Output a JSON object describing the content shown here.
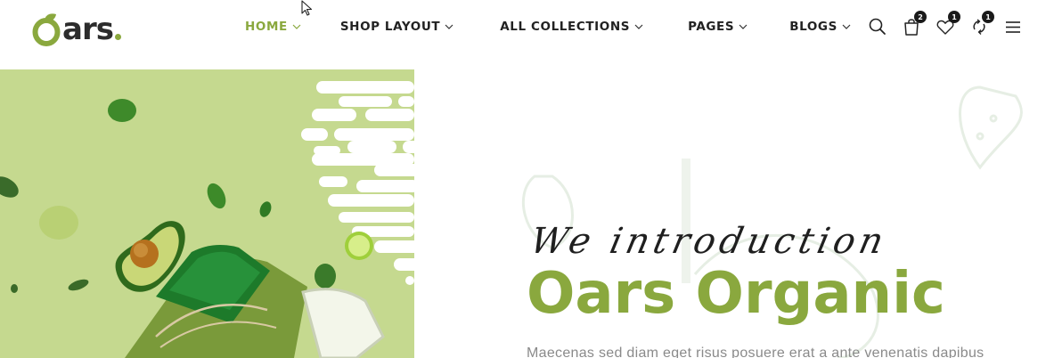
{
  "brand": {
    "logo_text": "ars",
    "logo_letter": "O",
    "accent_color": "#8aa83e"
  },
  "nav": {
    "items": [
      {
        "label": "HOME",
        "active": true
      },
      {
        "label": "SHOP LAYOUT",
        "active": false
      },
      {
        "label": "ALL COLLECTIONS",
        "active": false
      },
      {
        "label": "PAGES",
        "active": false
      },
      {
        "label": "BLOGS",
        "active": false
      }
    ]
  },
  "header_icons": {
    "search": {
      "icon": "search-icon"
    },
    "cart": {
      "icon": "shopping-bag-icon",
      "count": "2"
    },
    "wishlist": {
      "icon": "heart-icon",
      "count": "1"
    },
    "compare": {
      "icon": "refresh-icon",
      "count": "1"
    },
    "menu": {
      "icon": "hamburger-menu-icon"
    }
  },
  "hero": {
    "tagline": "We introduction",
    "title": "Oars Organic",
    "description": "Maecenas sed diam eget risus posuere erat a ante venenatis dapibus",
    "bg_color": "#c5d98f"
  }
}
